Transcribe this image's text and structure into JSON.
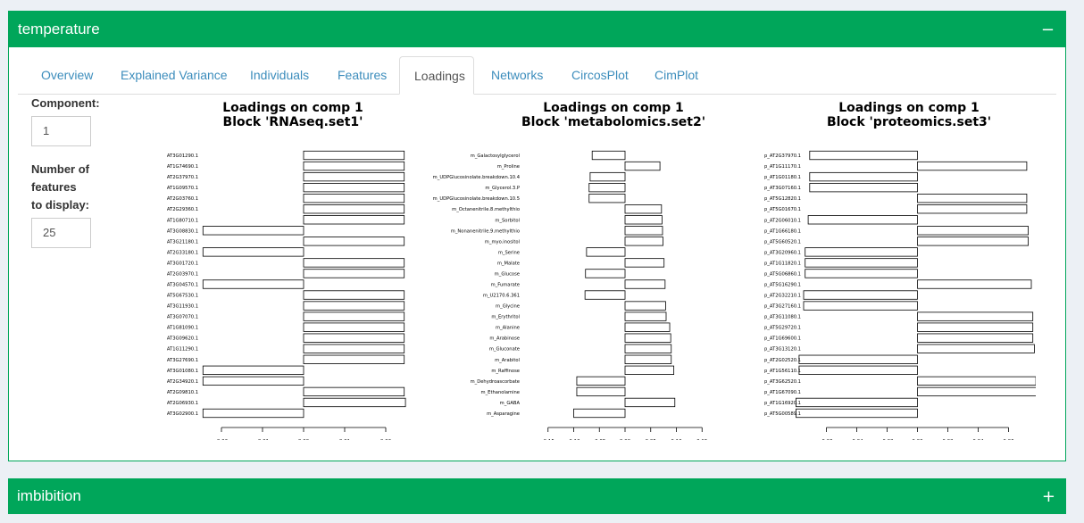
{
  "box1": {
    "title": "temperature",
    "collapse_symbol": "−"
  },
  "box2": {
    "title": "imbibition",
    "expand_symbol": "+"
  },
  "tabs": [
    {
      "label": "Overview"
    },
    {
      "label": "Explained Variance"
    },
    {
      "label": "Individuals"
    },
    {
      "label": "Features"
    },
    {
      "label": "Loadings",
      "active": true
    },
    {
      "label": "Networks"
    },
    {
      "label": "CircosPlot"
    },
    {
      "label": "CimPlot"
    }
  ],
  "sidebar": {
    "component_label": "Component:",
    "component_value": "1",
    "nfeatures_label_1": "Number of",
    "nfeatures_label_2": "features",
    "nfeatures_label_3": "to display:",
    "nfeatures_value": "25"
  },
  "colors": {
    "header": "#00a65a",
    "link": "#3c8dbc",
    "bar_fill": "#ffffff",
    "bar_stroke": "#000000"
  },
  "chart_data": [
    {
      "type": "bar",
      "orientation": "horizontal",
      "title_line1": "Loadings on comp 1",
      "title_line2": "Block 'RNAseq.set1'",
      "xlim": [
        -0.025,
        0.025
      ],
      "xticks": [
        -0.02,
        -0.01,
        0.0,
        0.01,
        0.02
      ],
      "xtick_labels": [
        "-0.02",
        "-0.01",
        "0.00",
        "0.01",
        "0.02"
      ],
      "categories": [
        "AT3G01290.1",
        "AT1G74690.1",
        "AT2G37970.1",
        "AT1G09570.1",
        "AT2G03760.1",
        "AT2G29360.1",
        "AT1G80710.1",
        "AT3G08830.1",
        "AT3G21180.1",
        "AT2G33180.1",
        "AT3G01720.1",
        "AT2G03970.1",
        "AT3G04570.1",
        "AT5G67530.1",
        "AT3G11930.1",
        "AT3G07070.1",
        "AT1G81090.1",
        "AT3G09620.1",
        "AT1G11290.1",
        "AT3G27690.1",
        "AT3G01080.1",
        "AT2G34920.1",
        "AT2G09810.1",
        "AT2G06930.1",
        "AT3G02900.1"
      ],
      "values": [
        0.0245,
        0.0245,
        0.0245,
        0.0245,
        0.0245,
        0.0245,
        0.0245,
        -0.0245,
        0.0245,
        -0.0245,
        0.0245,
        0.0245,
        -0.0245,
        0.0245,
        0.0245,
        0.0245,
        0.0245,
        0.0245,
        0.0245,
        0.0245,
        -0.0245,
        -0.0245,
        0.0245,
        0.0248,
        -0.0245
      ]
    },
    {
      "type": "bar",
      "orientation": "horizontal",
      "title_line1": "Loadings on comp 1",
      "title_line2": "Block 'metabolomics.set2'",
      "xlim": [
        -0.2,
        0.2
      ],
      "xticks": [
        -0.15,
        -0.1,
        -0.05,
        0.0,
        0.05,
        0.1,
        0.15
      ],
      "xtick_labels": [
        "-0.15",
        "-0.10",
        "-0.05",
        "0.00",
        "0.05",
        "0.10",
        "0.15"
      ],
      "categories": [
        "m_Galactosylglycerol",
        "m_Proline",
        "m_UDPGlucosinolate.breakdown.10.4",
        "m_Glycerol.3.P",
        "m_UDPGlucosinolate.breakdown.10.5",
        "m_Octanenitrile.8.methylthio",
        "m_Sorbitol",
        "m_Nonanenitrile.9.methylthio",
        "m_myo.inositol",
        "m_Serine",
        "m_Malate",
        "m_Glucose",
        "m_Fumarate",
        "m_U2170.6.361",
        "m_Glycine",
        "m_Erythritol",
        "m_Alanine",
        "m_Arabinose",
        "m_Gluconate",
        "m_Arabitol",
        "m_Raffinose",
        "m_Dehydroascorbate",
        "m_Ethanolamine",
        "m_GABA",
        "m_Asparagine"
      ],
      "values": [
        -0.064,
        0.068,
        -0.068,
        -0.07,
        -0.07,
        0.071,
        0.072,
        0.073,
        0.074,
        -0.075,
        0.076,
        -0.077,
        0.078,
        -0.078,
        0.079,
        0.08,
        0.087,
        0.089,
        0.09,
        0.09,
        0.095,
        -0.094,
        -0.094,
        0.097,
        -0.1
      ]
    },
    {
      "type": "bar",
      "orientation": "horizontal",
      "title_line1": "Loadings on comp 1",
      "title_line2": "Block 'proteomics.set3'",
      "xlim": [
        -0.075,
        0.075
      ],
      "xticks": [
        -0.06,
        -0.04,
        -0.02,
        0.0,
        0.02,
        0.04,
        0.06
      ],
      "xtick_labels": [
        "-0.06",
        "-0.04",
        "-0.02",
        "0.00",
        "0.02",
        "0.04",
        "0.06"
      ],
      "categories": [
        "p_AT2G37970.1",
        "p_AT1G11170.1",
        "p_AT1G01180.1",
        "p_AT3G07160.1",
        "p_AT5G12820.1",
        "p_AT5G01670.1",
        "p_AT2G06010.1",
        "p_AT1G66180.1",
        "p_AT5G60520.1",
        "p_AT3G20960.1",
        "p_AT1G11820.1",
        "p_AT5G06860.1",
        "p_AT5G16290.1",
        "p_AT2G32210.1",
        "p_AT3G27160.1",
        "p_AT3G11080.1",
        "p_AT5G29720.1",
        "p_AT1G69600.1",
        "p_AT3G13120.1",
        "p_AT2G02520.1",
        "p_AT1G56110.1",
        "p_AT3G62520.1",
        "p_AT1G67090.1",
        "p_AT1G16920.1",
        "p_AT5G00589.1"
      ],
      "values": [
        -0.071,
        0.072,
        -0.071,
        -0.071,
        0.072,
        0.072,
        -0.072,
        0.073,
        0.073,
        -0.074,
        -0.074,
        -0.074,
        0.075,
        -0.075,
        -0.075,
        0.076,
        0.076,
        0.076,
        0.077,
        -0.078,
        -0.078,
        0.078,
        0.079,
        -0.08,
        -0.08
      ]
    }
  ]
}
